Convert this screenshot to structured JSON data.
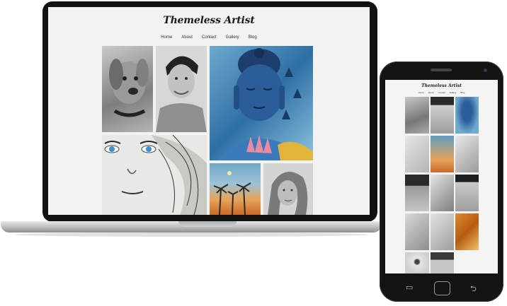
{
  "site": {
    "title": "Themeless Artist",
    "nav": [
      "Home",
      "About",
      "Contact",
      "Gallery",
      "Blog"
    ]
  },
  "colors": {
    "screen_bg": "#f2f2f2",
    "device_frame": "#121212",
    "text": "#333333"
  },
  "laptop_gallery": [
    {
      "name": "dog-pencil-sketch"
    },
    {
      "name": "man-portrait-sketch"
    },
    {
      "name": "blue-buddha-painting"
    },
    {
      "name": "woman-blue-eyes-sketch"
    },
    {
      "name": "palm-sunset-painting"
    },
    {
      "name": "girl-portrait-sketch"
    }
  ],
  "phone_gallery": [
    {
      "name": "dog-pencil-sketch"
    },
    {
      "name": "man-portrait-sketch"
    },
    {
      "name": "blue-buddha-painting"
    },
    {
      "name": "woman-face-sketch"
    },
    {
      "name": "palm-sunset-painting"
    },
    {
      "name": "girl-portrait-sketch"
    },
    {
      "name": "boy-portrait-sketch"
    },
    {
      "name": "girl-long-hair-sketch"
    },
    {
      "name": "dark-hair-face-sketch"
    },
    {
      "name": "wrapped-figure-sketch"
    },
    {
      "name": "woman-hood-sketch"
    },
    {
      "name": "tiger-painting"
    },
    {
      "name": "eye-sketch"
    },
    {
      "name": "woman-smile-sketch"
    }
  ],
  "phone_softkeys": {
    "back": "⮌",
    "recent": "▭"
  }
}
